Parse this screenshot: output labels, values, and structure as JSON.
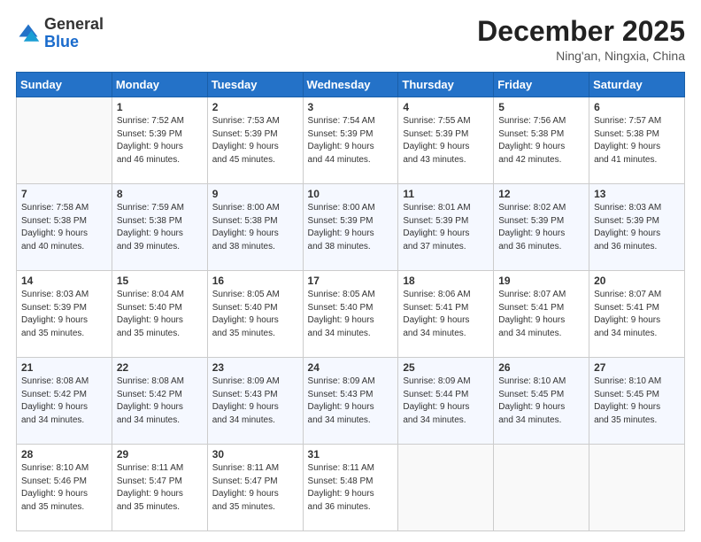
{
  "logo": {
    "general": "General",
    "blue": "Blue"
  },
  "header": {
    "month": "December 2025",
    "location": "Ning'an, Ningxia, China"
  },
  "weekdays": [
    "Sunday",
    "Monday",
    "Tuesday",
    "Wednesday",
    "Thursday",
    "Friday",
    "Saturday"
  ],
  "weeks": [
    [
      {
        "day": "",
        "info": ""
      },
      {
        "day": "1",
        "info": "Sunrise: 7:52 AM\nSunset: 5:39 PM\nDaylight: 9 hours\nand 46 minutes."
      },
      {
        "day": "2",
        "info": "Sunrise: 7:53 AM\nSunset: 5:39 PM\nDaylight: 9 hours\nand 45 minutes."
      },
      {
        "day": "3",
        "info": "Sunrise: 7:54 AM\nSunset: 5:39 PM\nDaylight: 9 hours\nand 44 minutes."
      },
      {
        "day": "4",
        "info": "Sunrise: 7:55 AM\nSunset: 5:39 PM\nDaylight: 9 hours\nand 43 minutes."
      },
      {
        "day": "5",
        "info": "Sunrise: 7:56 AM\nSunset: 5:38 PM\nDaylight: 9 hours\nand 42 minutes."
      },
      {
        "day": "6",
        "info": "Sunrise: 7:57 AM\nSunset: 5:38 PM\nDaylight: 9 hours\nand 41 minutes."
      }
    ],
    [
      {
        "day": "7",
        "info": "Sunrise: 7:58 AM\nSunset: 5:38 PM\nDaylight: 9 hours\nand 40 minutes."
      },
      {
        "day": "8",
        "info": "Sunrise: 7:59 AM\nSunset: 5:38 PM\nDaylight: 9 hours\nand 39 minutes."
      },
      {
        "day": "9",
        "info": "Sunrise: 8:00 AM\nSunset: 5:38 PM\nDaylight: 9 hours\nand 38 minutes."
      },
      {
        "day": "10",
        "info": "Sunrise: 8:00 AM\nSunset: 5:39 PM\nDaylight: 9 hours\nand 38 minutes."
      },
      {
        "day": "11",
        "info": "Sunrise: 8:01 AM\nSunset: 5:39 PM\nDaylight: 9 hours\nand 37 minutes."
      },
      {
        "day": "12",
        "info": "Sunrise: 8:02 AM\nSunset: 5:39 PM\nDaylight: 9 hours\nand 36 minutes."
      },
      {
        "day": "13",
        "info": "Sunrise: 8:03 AM\nSunset: 5:39 PM\nDaylight: 9 hours\nand 36 minutes."
      }
    ],
    [
      {
        "day": "14",
        "info": "Sunrise: 8:03 AM\nSunset: 5:39 PM\nDaylight: 9 hours\nand 35 minutes."
      },
      {
        "day": "15",
        "info": "Sunrise: 8:04 AM\nSunset: 5:40 PM\nDaylight: 9 hours\nand 35 minutes."
      },
      {
        "day": "16",
        "info": "Sunrise: 8:05 AM\nSunset: 5:40 PM\nDaylight: 9 hours\nand 35 minutes."
      },
      {
        "day": "17",
        "info": "Sunrise: 8:05 AM\nSunset: 5:40 PM\nDaylight: 9 hours\nand 34 minutes."
      },
      {
        "day": "18",
        "info": "Sunrise: 8:06 AM\nSunset: 5:41 PM\nDaylight: 9 hours\nand 34 minutes."
      },
      {
        "day": "19",
        "info": "Sunrise: 8:07 AM\nSunset: 5:41 PM\nDaylight: 9 hours\nand 34 minutes."
      },
      {
        "day": "20",
        "info": "Sunrise: 8:07 AM\nSunset: 5:41 PM\nDaylight: 9 hours\nand 34 minutes."
      }
    ],
    [
      {
        "day": "21",
        "info": "Sunrise: 8:08 AM\nSunset: 5:42 PM\nDaylight: 9 hours\nand 34 minutes."
      },
      {
        "day": "22",
        "info": "Sunrise: 8:08 AM\nSunset: 5:42 PM\nDaylight: 9 hours\nand 34 minutes."
      },
      {
        "day": "23",
        "info": "Sunrise: 8:09 AM\nSunset: 5:43 PM\nDaylight: 9 hours\nand 34 minutes."
      },
      {
        "day": "24",
        "info": "Sunrise: 8:09 AM\nSunset: 5:43 PM\nDaylight: 9 hours\nand 34 minutes."
      },
      {
        "day": "25",
        "info": "Sunrise: 8:09 AM\nSunset: 5:44 PM\nDaylight: 9 hours\nand 34 minutes."
      },
      {
        "day": "26",
        "info": "Sunrise: 8:10 AM\nSunset: 5:45 PM\nDaylight: 9 hours\nand 34 minutes."
      },
      {
        "day": "27",
        "info": "Sunrise: 8:10 AM\nSunset: 5:45 PM\nDaylight: 9 hours\nand 35 minutes."
      }
    ],
    [
      {
        "day": "28",
        "info": "Sunrise: 8:10 AM\nSunset: 5:46 PM\nDaylight: 9 hours\nand 35 minutes."
      },
      {
        "day": "29",
        "info": "Sunrise: 8:11 AM\nSunset: 5:47 PM\nDaylight: 9 hours\nand 35 minutes."
      },
      {
        "day": "30",
        "info": "Sunrise: 8:11 AM\nSunset: 5:47 PM\nDaylight: 9 hours\nand 35 minutes."
      },
      {
        "day": "31",
        "info": "Sunrise: 8:11 AM\nSunset: 5:48 PM\nDaylight: 9 hours\nand 36 minutes."
      },
      {
        "day": "",
        "info": ""
      },
      {
        "day": "",
        "info": ""
      },
      {
        "day": "",
        "info": ""
      }
    ]
  ]
}
